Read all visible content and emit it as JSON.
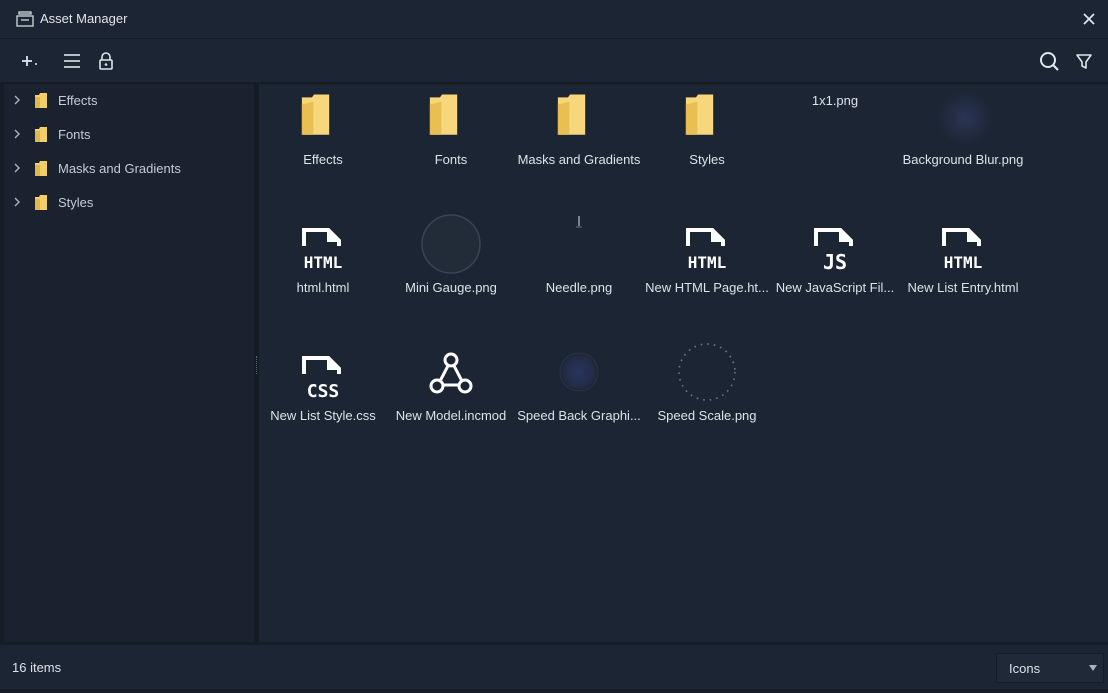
{
  "window": {
    "title": "Asset Manager",
    "app_icon": "inbox-tray-icon",
    "close_icon": "close-icon"
  },
  "toolbar": {
    "add_icon": "plus-dropdown-icon",
    "list_icon": "menu-lines-icon",
    "lock_icon": "lock-icon",
    "search_icon": "search-icon",
    "filter_icon": "filter-icon"
  },
  "sidebar": {
    "items": [
      {
        "label": "Effects"
      },
      {
        "label": "Fonts"
      },
      {
        "label": "Masks and Gradients"
      },
      {
        "label": "Styles"
      }
    ]
  },
  "assets": [
    {
      "name": "Effects",
      "kind": "folder"
    },
    {
      "name": "Fonts",
      "kind": "folder"
    },
    {
      "name": "Masks and Gradients",
      "kind": "folder"
    },
    {
      "name": "Styles",
      "kind": "folder"
    },
    {
      "name": "1x1.png",
      "kind": "image-dot"
    },
    {
      "name": "Background Blur.png",
      "kind": "image-blur"
    },
    {
      "name": "html.html",
      "kind": "file",
      "badge": "HTML"
    },
    {
      "name": "Mini Gauge.png",
      "kind": "image-gauge"
    },
    {
      "name": "Needle.png",
      "kind": "image-needle"
    },
    {
      "name": "New HTML Page.ht...",
      "kind": "file",
      "badge": "HTML"
    },
    {
      "name": "New JavaScript Fil...",
      "kind": "file",
      "badge": "JS"
    },
    {
      "name": "New List Entry.html",
      "kind": "file",
      "badge": "HTML"
    },
    {
      "name": "New List Style.css",
      "kind": "file",
      "badge": "CSS"
    },
    {
      "name": "New Model.incmod",
      "kind": "model"
    },
    {
      "name": "Speed Back Graphi...",
      "kind": "image-speedback"
    },
    {
      "name": "Speed Scale.png",
      "kind": "image-scale"
    }
  ],
  "status": {
    "count": "16 items"
  },
  "view_mode": {
    "selected": "Icons"
  },
  "colors": {
    "folder": "#f2cf6b",
    "background": "#1c2533",
    "text": "#dde2e8"
  }
}
